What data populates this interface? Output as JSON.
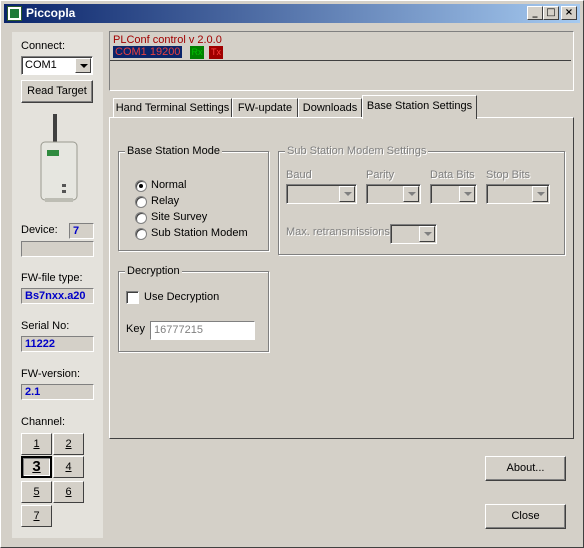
{
  "window": {
    "title": "Piccopla"
  },
  "titlebar": {
    "minimize": "_",
    "maximize": "□",
    "close": "×"
  },
  "left": {
    "connect_label": "Connect:",
    "port_selected": "COM1",
    "read_target": "Read Target",
    "device_label": "Device:",
    "device_value": "7",
    "fw_type_label": "FW-file type:",
    "fw_type_value": "Bs7nxx.a20",
    "serial_label": "Serial No:",
    "serial_value": "11222",
    "fw_version_label": "FW-version:",
    "fw_version_value": "2.1",
    "channel_label": "Channel:",
    "channels": [
      "1",
      "2",
      "3",
      "4",
      "5",
      "6",
      "7"
    ],
    "active_channel": "3"
  },
  "status": {
    "title": "PLConf control v 2.0.0",
    "port_status": "COM1 19200",
    "rx": "Rx",
    "tx": "Tx"
  },
  "tabs": [
    "Hand Terminal Settings",
    "FW-update",
    "Downloads",
    "Base Station Settings"
  ],
  "active_tab": "Base Station Settings",
  "base_mode": {
    "title": "Base Station Mode",
    "options": [
      "Normal",
      "Relay",
      "Site Survey",
      "Sub Station Modem"
    ],
    "selected": "Normal"
  },
  "decryption": {
    "title": "Decryption",
    "use_label": "Use Decryption",
    "key_label": "Key",
    "key_value": "16777215"
  },
  "modem": {
    "title": "Sub Station Modem Settings",
    "baud_label": "Baud",
    "parity_label": "Parity",
    "data_bits_label": "Data Bits",
    "stop_bits_label": "Stop Bits",
    "retrans_label": "Max. retransmissions:"
  },
  "buttons": {
    "about": "About...",
    "close": "Close"
  },
  "colors": {
    "titlebar_start": "#0a246a",
    "status_blue": "#0000c8",
    "status_red": "#a00000",
    "rx_green": "#008000",
    "tx_red": "#a00000"
  }
}
